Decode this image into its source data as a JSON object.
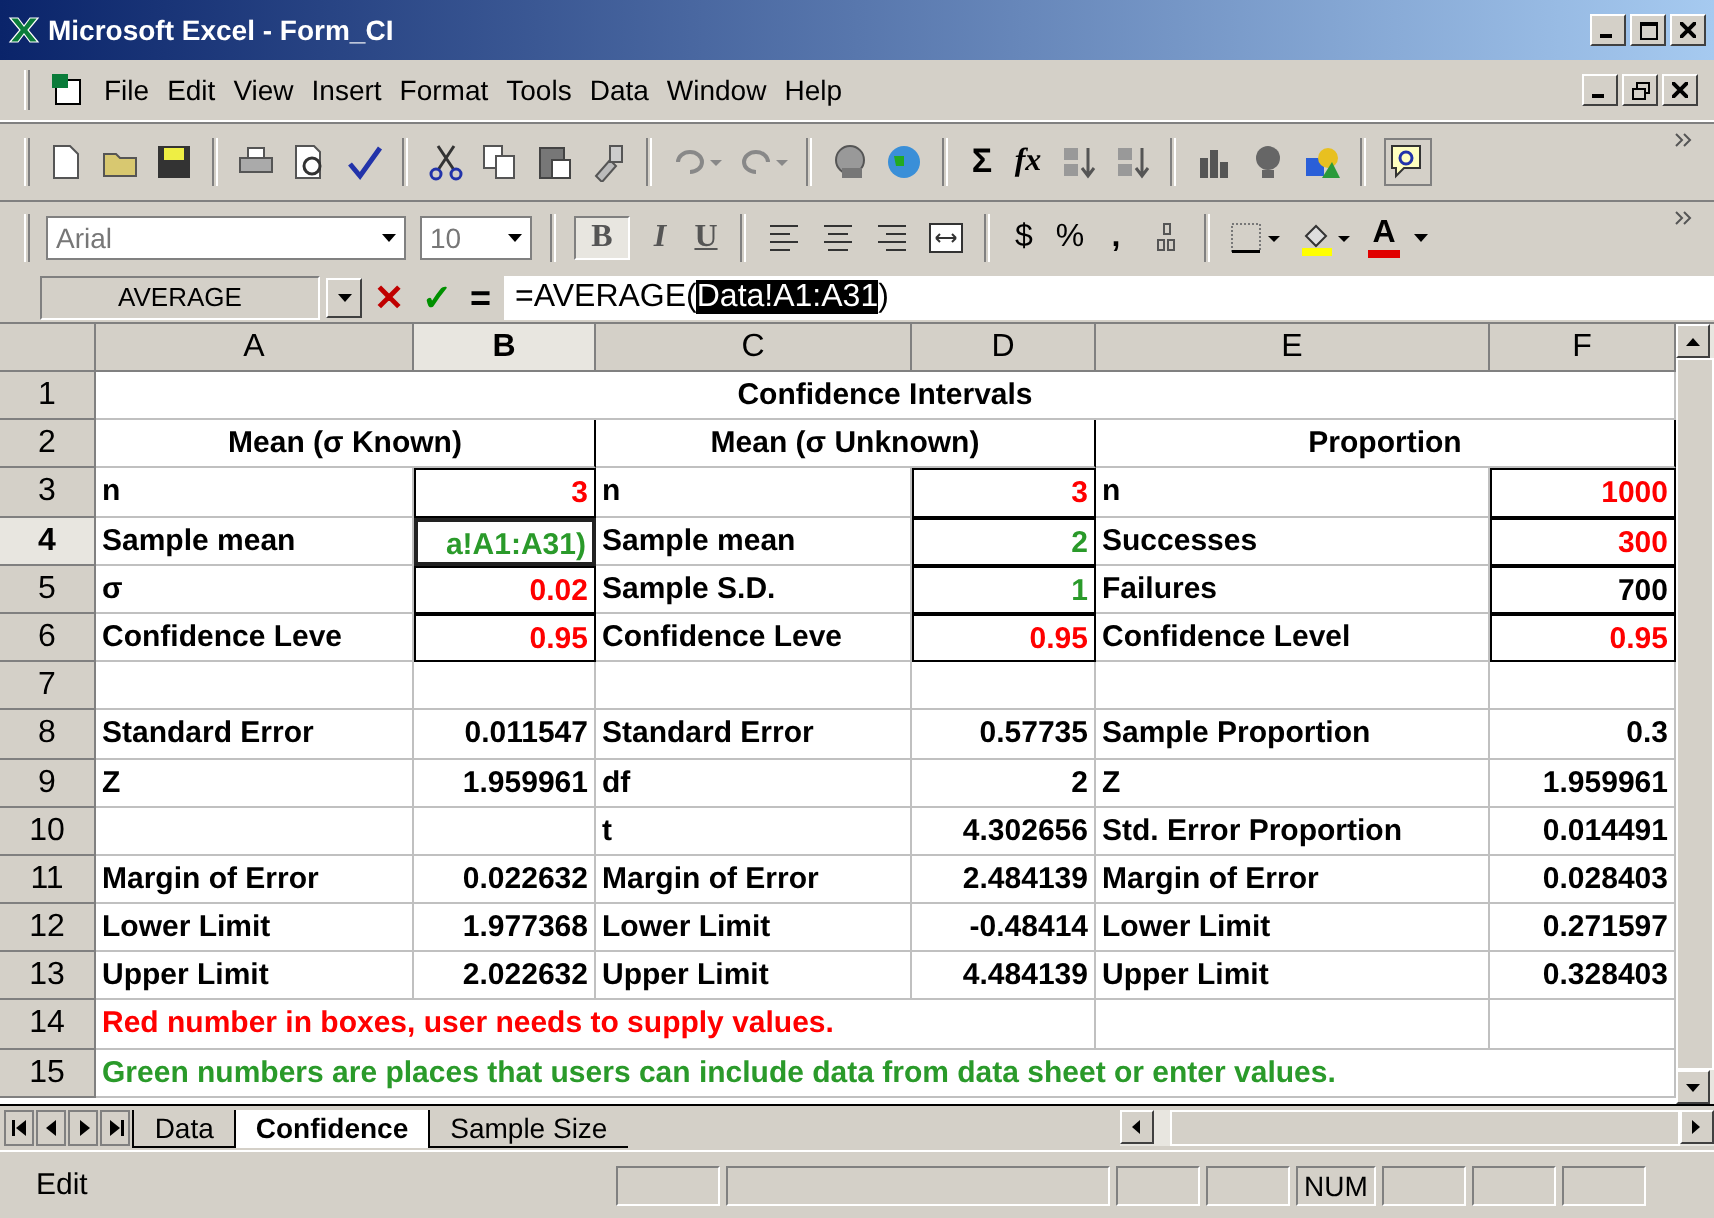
{
  "window": {
    "title": "Microsoft Excel - Form_CI"
  },
  "menu": [
    {
      "label": "File"
    },
    {
      "label": "Edit"
    },
    {
      "label": "View"
    },
    {
      "label": "Insert"
    },
    {
      "label": "Format"
    },
    {
      "label": "Tools"
    },
    {
      "label": "Data"
    },
    {
      "label": "Window"
    },
    {
      "label": "Help"
    }
  ],
  "toolbar": {
    "sum": "Σ",
    "fx": "fx"
  },
  "format_bar": {
    "font": "Arial",
    "size": "10",
    "bold": "B",
    "italic": "I",
    "underline": "U",
    "currency": "$",
    "percent": "%",
    "comma": ",",
    "font_color": "A"
  },
  "formula_bar": {
    "name_box": "AVERAGE",
    "cancel": "✕",
    "enter": "✓",
    "equals": "=",
    "before": "=AVERAGE(",
    "selected": "Data!A1:A31",
    "after": ")"
  },
  "columns": [
    {
      "label": "A",
      "selected": false
    },
    {
      "label": "B",
      "selected": true
    },
    {
      "label": "C",
      "selected": false
    },
    {
      "label": "D",
      "selected": false
    },
    {
      "label": "E",
      "selected": false
    },
    {
      "label": "F",
      "selected": false
    }
  ],
  "rows": [
    {
      "num": "1",
      "selected": false,
      "cells": [
        {
          "text": "Confidence Intervals",
          "kind": "title"
        }
      ]
    },
    {
      "num": "2",
      "selected": false,
      "cells": [
        {
          "text": "Mean (σ Known)",
          "kind": "header"
        },
        {
          "text": "Mean (σ Unknown)",
          "kind": "header"
        },
        {
          "text": "Proportion",
          "kind": "header"
        }
      ]
    },
    {
      "num": "3",
      "selected": false,
      "cells": [
        {
          "text": "n",
          "kind": "label"
        },
        {
          "text": "3",
          "kind": "input",
          "boxed": true
        },
        {
          "text": "n",
          "kind": "label"
        },
        {
          "text": "3",
          "kind": "input",
          "boxed": true
        },
        {
          "text": "n",
          "kind": "label"
        },
        {
          "text": "1000",
          "kind": "input",
          "boxed": true
        }
      ]
    },
    {
      "num": "4",
      "selected": true,
      "cells": [
        {
          "text": "Sample mean",
          "kind": "label"
        },
        {
          "text": "a!A1:A31)",
          "kind": "editing",
          "boxed": true
        },
        {
          "text": "Sample mean",
          "kind": "label"
        },
        {
          "text": "2",
          "kind": "data",
          "boxed": true
        },
        {
          "text": "Successes",
          "kind": "label"
        },
        {
          "text": "300",
          "kind": "input",
          "boxed": true
        }
      ]
    },
    {
      "num": "5",
      "selected": false,
      "cells": [
        {
          "text": "σ",
          "kind": "label"
        },
        {
          "text": "0.02",
          "kind": "input",
          "boxed": true
        },
        {
          "text": "Sample S.D.",
          "kind": "label"
        },
        {
          "text": "1",
          "kind": "data",
          "boxed": true
        },
        {
          "text": "Failures",
          "kind": "label"
        },
        {
          "text": "700",
          "kind": "value",
          "boxed": true
        }
      ]
    },
    {
      "num": "6",
      "selected": false,
      "cells": [
        {
          "text": "Confidence Leve",
          "kind": "label"
        },
        {
          "text": "0.95",
          "kind": "input",
          "boxed": true
        },
        {
          "text": "Confidence Leve",
          "kind": "label"
        },
        {
          "text": "0.95",
          "kind": "input",
          "boxed": true
        },
        {
          "text": "Confidence Level",
          "kind": "label"
        },
        {
          "text": "0.95",
          "kind": "input",
          "boxed": true
        }
      ]
    },
    {
      "num": "7",
      "selected": false,
      "cells": [
        {
          "kind": "empty"
        },
        {
          "kind": "empty"
        },
        {
          "kind": "empty"
        },
        {
          "kind": "empty"
        },
        {
          "kind": "empty"
        },
        {
          "kind": "empty"
        }
      ]
    },
    {
      "num": "8",
      "selected": false,
      "cells": [
        {
          "text": "Standard Error",
          "kind": "label"
        },
        {
          "text": "0.011547",
          "kind": "value"
        },
        {
          "text": "Standard Error",
          "kind": "label"
        },
        {
          "text": "0.57735",
          "kind": "value"
        },
        {
          "text": "Sample Proportion",
          "kind": "label"
        },
        {
          "text": "0.3",
          "kind": "value"
        }
      ]
    },
    {
      "num": "9",
      "selected": false,
      "cells": [
        {
          "text": "Z",
          "kind": "label"
        },
        {
          "text": "1.959961",
          "kind": "value"
        },
        {
          "text": "df",
          "kind": "label"
        },
        {
          "text": "2",
          "kind": "value"
        },
        {
          "text": "Z",
          "kind": "label"
        },
        {
          "text": "1.959961",
          "kind": "value"
        }
      ]
    },
    {
      "num": "10",
      "selected": false,
      "cells": [
        {
          "kind": "empty"
        },
        {
          "kind": "empty"
        },
        {
          "text": "t",
          "kind": "label"
        },
        {
          "text": "4.302656",
          "kind": "value"
        },
        {
          "text": "Std. Error Proportion",
          "kind": "label"
        },
        {
          "text": "0.014491",
          "kind": "value"
        }
      ]
    },
    {
      "num": "11",
      "selected": false,
      "cells": [
        {
          "text": "Margin of Error",
          "kind": "label"
        },
        {
          "text": "0.022632",
          "kind": "value"
        },
        {
          "text": "Margin of Error",
          "kind": "label"
        },
        {
          "text": "2.484139",
          "kind": "value"
        },
        {
          "text": "Margin of Error",
          "kind": "label"
        },
        {
          "text": "0.028403",
          "kind": "value"
        }
      ]
    },
    {
      "num": "12",
      "selected": false,
      "cells": [
        {
          "text": "Lower Limit",
          "kind": "label"
        },
        {
          "text": "1.977368",
          "kind": "value"
        },
        {
          "text": "Lower Limit",
          "kind": "label"
        },
        {
          "text": "-0.48414",
          "kind": "value"
        },
        {
          "text": "Lower Limit",
          "kind": "label"
        },
        {
          "text": "0.271597",
          "kind": "value"
        }
      ]
    },
    {
      "num": "13",
      "selected": false,
      "cells": [
        {
          "text": "Upper Limit",
          "kind": "label"
        },
        {
          "text": "2.022632",
          "kind": "value"
        },
        {
          "text": "Upper Limit",
          "kind": "label"
        },
        {
          "text": "4.484139",
          "kind": "value"
        },
        {
          "text": "Upper Limit",
          "kind": "label"
        },
        {
          "text": "0.328403",
          "kind": "value"
        }
      ]
    },
    {
      "num": "14",
      "selected": false,
      "cells": [
        {
          "text": "Red number in boxes, user needs to supply values.",
          "kind": "note-red"
        },
        {
          "kind": "empty"
        },
        {
          "kind": "empty"
        }
      ]
    },
    {
      "num": "15",
      "selected": false,
      "cells": [
        {
          "text": "Green numbers are places that users can include data from data sheet or enter values.",
          "kind": "note-green"
        }
      ]
    }
  ],
  "sheet_tabs": [
    {
      "label": "Data",
      "selected": false
    },
    {
      "label": "Confidence",
      "selected": true
    },
    {
      "label": "Sample Size",
      "selected": false
    }
  ],
  "status_bar": {
    "mode": "Edit",
    "num": "NUM"
  }
}
